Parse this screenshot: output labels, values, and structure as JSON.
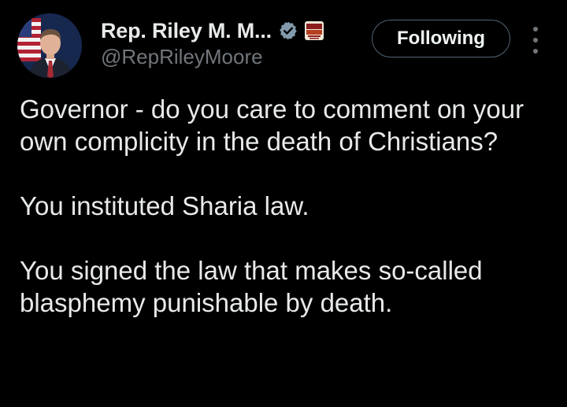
{
  "author": {
    "display_name": "Rep. Riley M. M...",
    "handle": "@RepRileyMoore",
    "verified_icon": "verified-badge-icon",
    "affiliate_icon": "affiliate-badge-icon"
  },
  "actions": {
    "follow_label": "Following",
    "more_icon": "more-vertical-icon"
  },
  "tweet": {
    "paragraphs": [
      "Governor - do you care to comment on your own complicity in the death of Christians?",
      "You instituted Sharia law.",
      "You signed the law that makes so-called blasphemy punishable by death."
    ]
  },
  "colors": {
    "background": "#000000",
    "text": "#e7e9ea",
    "secondary_text": "#71767b",
    "verified": "#829aab",
    "button_border": "#536471"
  }
}
